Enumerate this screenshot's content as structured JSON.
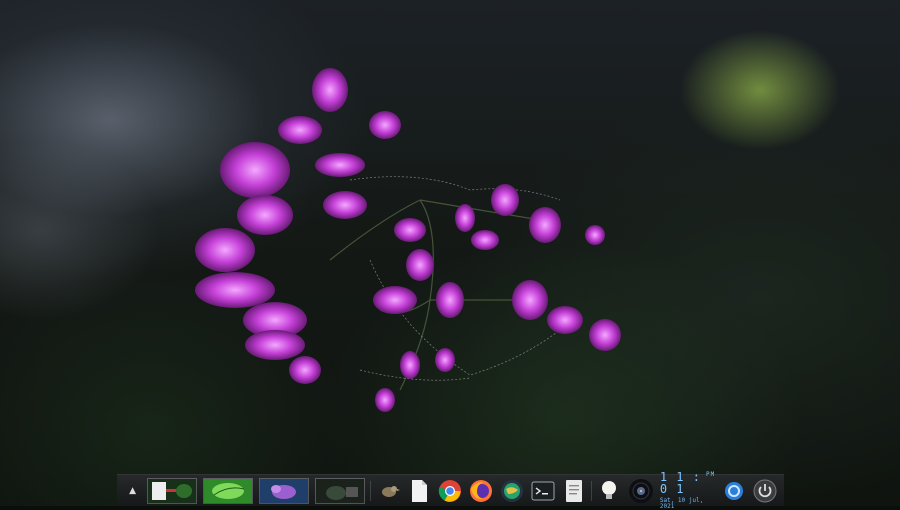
{
  "dock": {
    "toggle_icon": "chevron-up-icon",
    "thumbnails": [
      {
        "name": "thumbnail-document-red"
      },
      {
        "name": "thumbnail-green-leaf"
      },
      {
        "name": "thumbnail-purple-flowers"
      },
      {
        "name": "thumbnail-dark-cat"
      }
    ],
    "apps": [
      {
        "name": "bird-app-icon"
      },
      {
        "name": "document-icon"
      },
      {
        "name": "chrome-icon"
      },
      {
        "name": "firefox-icon"
      },
      {
        "name": "globe-icon"
      },
      {
        "name": "terminal-icon"
      },
      {
        "name": "notes-icon"
      },
      {
        "name": "lightbulb-icon"
      },
      {
        "name": "vinyl-icon"
      }
    ],
    "clock": {
      "time": "1 1 : 0 1",
      "ampm": "PM",
      "date": "Sat, 10 jul, 2021"
    },
    "system_icons": [
      {
        "name": "system-tray-icon"
      },
      {
        "name": "power-icon"
      }
    ],
    "accent_color": "#7fc4ff"
  }
}
